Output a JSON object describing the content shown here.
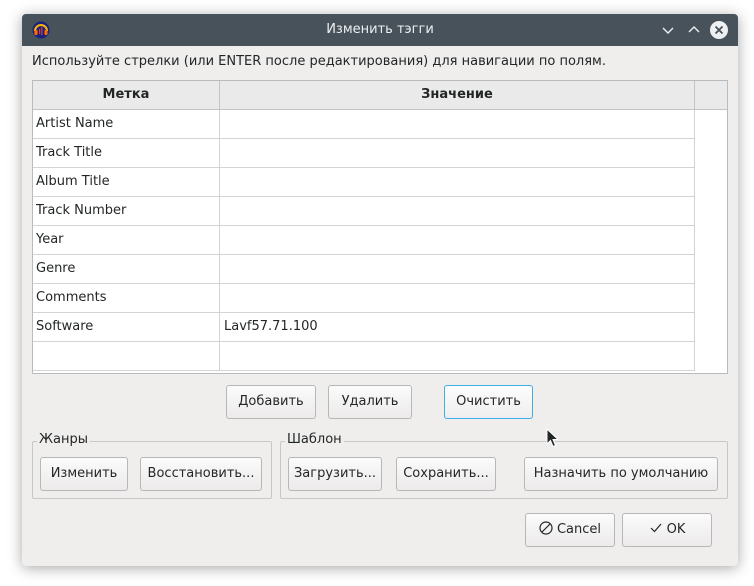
{
  "window": {
    "title": "Изменить тэгги",
    "app_icon": "audacity-icon"
  },
  "hint": "Используйте стрелки (или ENTER после редактирования) для навигации по полям.",
  "table": {
    "headers": {
      "label": "Метка",
      "value": "Значение"
    },
    "rows": [
      {
        "label": "Artist Name",
        "value": ""
      },
      {
        "label": "Track Title",
        "value": ""
      },
      {
        "label": "Album Title",
        "value": ""
      },
      {
        "label": "Track Number",
        "value": ""
      },
      {
        "label": "Year",
        "value": ""
      },
      {
        "label": "Genre",
        "value": ""
      },
      {
        "label": "Comments",
        "value": ""
      },
      {
        "label": "Software",
        "value": "Lavf57.71.100"
      },
      {
        "label": "",
        "value": ""
      }
    ]
  },
  "table_buttons": {
    "add": "Добавить",
    "remove": "Удалить",
    "clear": "Очистить"
  },
  "genres": {
    "title": "Жанры",
    "edit": "Изменить",
    "reset": "Восстановить..."
  },
  "template": {
    "title": "Шаблон",
    "load": "Загрузить...",
    "save": "Сохранить...",
    "set_default": "Назначить по умолчанию"
  },
  "footer": {
    "cancel": "Cancel",
    "ok": "OK"
  },
  "colors": {
    "titlebar": "#47525a",
    "window_bg": "#efeeed",
    "hover_border": "#3daee9"
  }
}
